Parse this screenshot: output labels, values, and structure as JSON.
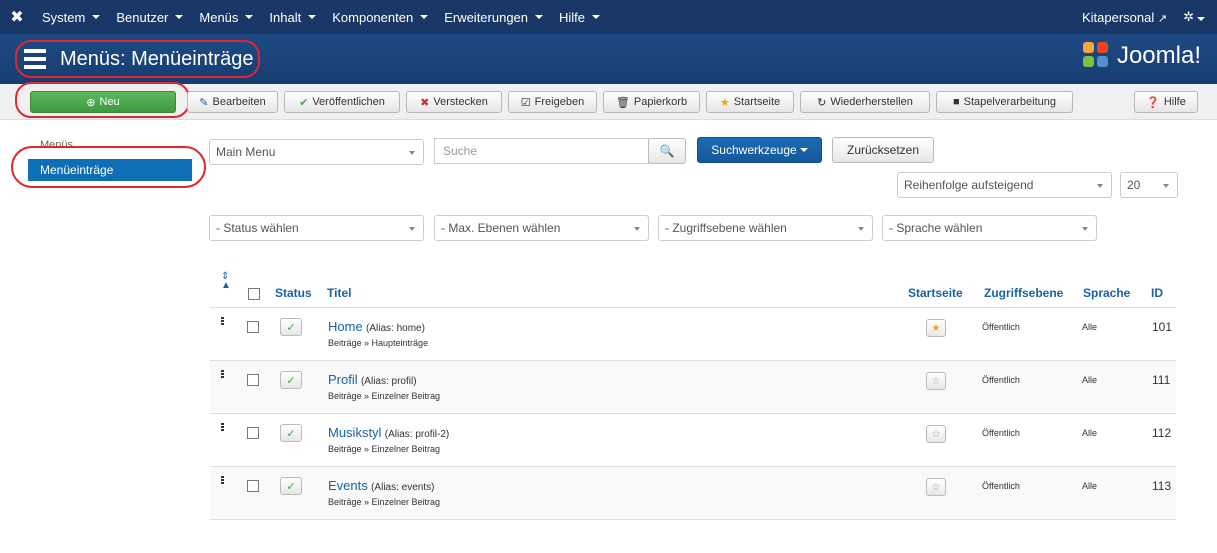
{
  "nav": {
    "menus": [
      "System",
      "Benutzer",
      "Menüs",
      "Inhalt",
      "Komponenten",
      "Erweiterungen",
      "Hilfe"
    ],
    "site_link": "Kitapersonal",
    "brand": "Joomla!"
  },
  "header": {
    "title": "Menüs: Menüeinträge"
  },
  "toolbar": {
    "new": "Neu",
    "edit": "Bearbeiten",
    "publish": "Veröffentlichen",
    "unpublish": "Verstecken",
    "checkin": "Freigeben",
    "trash": "Papierkorb",
    "home": "Startseite",
    "rebuild": "Wiederherstellen",
    "batch": "Stapelverarbeitung",
    "help": "Hilfe"
  },
  "sidebar": {
    "items": [
      {
        "label": "Menüs",
        "active": false
      },
      {
        "label": "Menüeinträge",
        "active": true
      }
    ]
  },
  "filters": {
    "menu_select": "Main Menu",
    "search_placeholder": "Suche",
    "search_tools": "Suchwerkzeuge",
    "reset": "Zurücksetzen",
    "ordering": "Reihenfolge aufsteigend",
    "limit": "20",
    "status": "- Status wählen",
    "levels": "- Max. Ebenen wählen",
    "access": "- Zugriffsebene wählen",
    "language": "- Sprache wählen"
  },
  "table": {
    "headers": {
      "status": "Status",
      "title": "Titel",
      "home": "Startseite",
      "access": "Zugriffsebene",
      "language": "Sprache",
      "id": "ID"
    },
    "rows": [
      {
        "title": "Home",
        "alias": "(Alias: home)",
        "sub": "Beiträge » Haupteinträge",
        "home": true,
        "access": "Öffentlich",
        "language": "Alle",
        "id": "101"
      },
      {
        "title": "Profil",
        "alias": "(Alias: profil)",
        "sub": "Beiträge » Einzelner Beitrag",
        "home": false,
        "access": "Öffentlich",
        "language": "Alle",
        "id": "111"
      },
      {
        "title": "Musikstyl",
        "alias": "(Alias: profil-2)",
        "sub": "Beiträge » Einzelner Beitrag",
        "home": false,
        "access": "Öffentlich",
        "language": "Alle",
        "id": "112"
      },
      {
        "title": "Events",
        "alias": "(Alias: events)",
        "sub": "Beiträge » Einzelner Beitrag",
        "home": false,
        "access": "Öffentlich",
        "language": "Alle",
        "id": "113"
      }
    ]
  },
  "colors": {
    "nav": "#1a3867",
    "header": "#1e4a84",
    "green": "#4cae4c",
    "primary": "#1b6bb5",
    "highlight": "#e0262f"
  }
}
